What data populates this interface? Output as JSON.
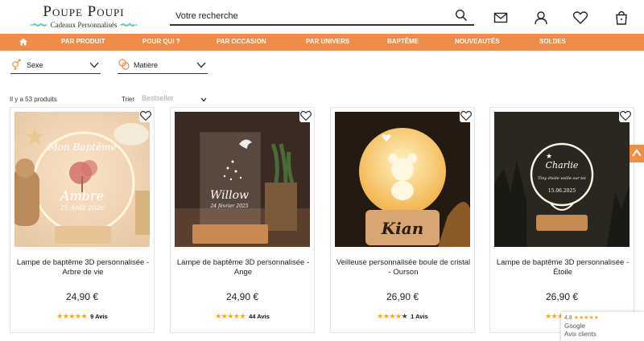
{
  "brand": {
    "name": "Poupe Poupi",
    "tagline": "Cadeaux Personnalisés"
  },
  "search": {
    "placeholder": "Votre recherche"
  },
  "nav": {
    "items": [
      {
        "label": "PAR PRODUIT"
      },
      {
        "label": "POUR QUI ?"
      },
      {
        "label": "PAR OCCASION"
      },
      {
        "label": "PAR UNIVERS"
      },
      {
        "label": "BAPTÊME"
      },
      {
        "label": "NOUVEAUTÉS"
      },
      {
        "label": "SOLDES"
      }
    ]
  },
  "filters": {
    "sexe": "Sexe",
    "matiere": "Matière"
  },
  "listing": {
    "count": "Il y a 53 produits",
    "sort_label": "Trier",
    "sort_value": "Bestseller"
  },
  "products": [
    {
      "title": "Lampe de baptême 3D personnalisée - Arbre de vie",
      "price": "24,90 €",
      "rating": 5,
      "reviews": "9 Avis",
      "img_text_1": "Mon Baptême",
      "img_text_2": "Ambre",
      "img_text_3": "25 Août 2026"
    },
    {
      "title": "Lampe de baptême 3D personnalisée - Ange",
      "price": "24,90 €",
      "rating": 5,
      "reviews": "44 Avis",
      "img_text_1": "Willow",
      "img_text_2": "24 février 2025",
      "img_text_3": ""
    },
    {
      "title": "Veilleuse personnalisée boule de cristal - Ourson",
      "price": "26,90 €",
      "rating": 4,
      "reviews": "1 Avis",
      "img_text_1": "Kian",
      "img_text_2": "",
      "img_text_3": ""
    },
    {
      "title": "Lampe de baptême 3D personnalisée - Étoile",
      "price": "26,90 €",
      "rating": 5,
      "reviews": "",
      "img_text_1": "Charlie",
      "img_text_2": "Tiny étoile veille sur toi",
      "img_text_3": "15.06.2025"
    }
  ],
  "google_badge": {
    "score": "4,8",
    "name": "Google",
    "sub": "Avis clients"
  },
  "colors": {
    "accent": "#f08c4a",
    "star": "#f5a623"
  }
}
